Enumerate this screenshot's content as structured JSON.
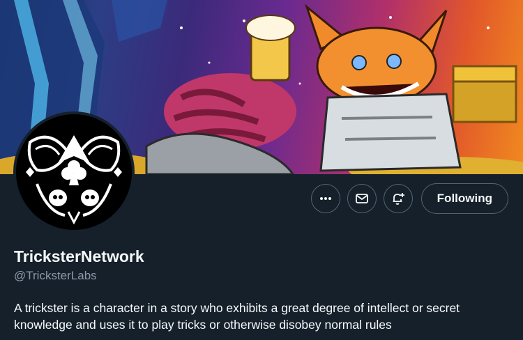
{
  "profile": {
    "display_name": "TricksterNetwork",
    "handle": "@TricksterLabs",
    "bio": "A trickster is a character in a story who exhibits a great degree of intellect or secret knowledge and uses it to play tricks or otherwise disobey normal rules"
  },
  "actions": {
    "more_icon": "more-horizontal-icon",
    "message_icon": "envelope-icon",
    "notify_icon": "bell-plus-icon",
    "follow_label": "Following"
  },
  "colors": {
    "background": "#15202b",
    "text_primary": "#f7f9f9",
    "text_secondary": "#8b98a5",
    "button_border": "#536471"
  }
}
